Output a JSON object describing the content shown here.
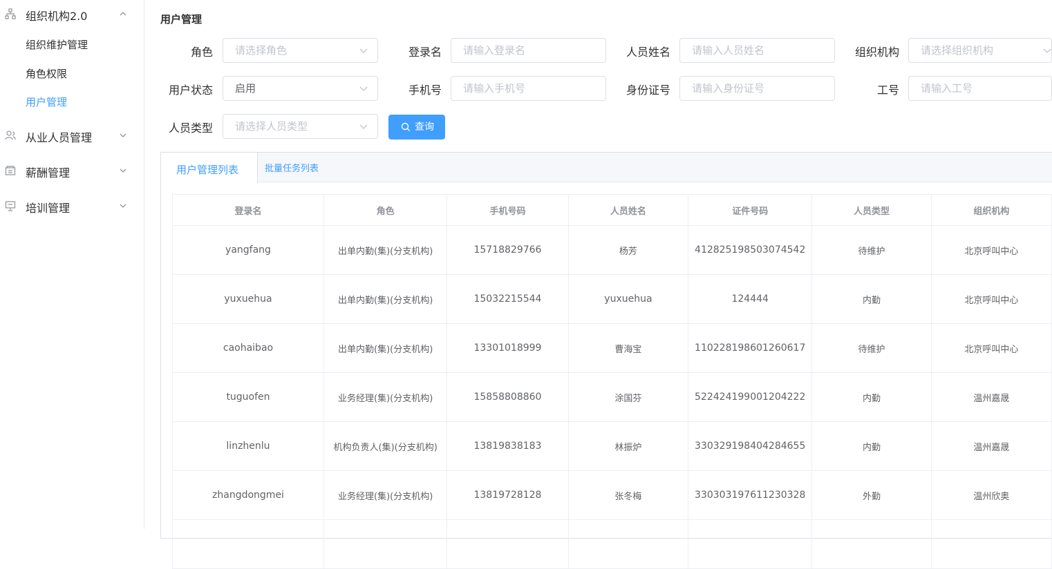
{
  "sidebar": {
    "groups": [
      {
        "label": "组织机构2.0",
        "icon": "org-chart-icon",
        "expanded": true,
        "items": [
          {
            "label": "组织维护管理",
            "active": false
          },
          {
            "label": "角色权限",
            "active": false
          },
          {
            "label": "用户管理",
            "active": true
          }
        ]
      },
      {
        "label": "从业人员管理",
        "icon": "people-icon",
        "expanded": false
      },
      {
        "label": "薪酬管理",
        "icon": "wallet-icon",
        "expanded": false
      },
      {
        "label": "培训管理",
        "icon": "presentation-icon",
        "expanded": false
      }
    ]
  },
  "page": {
    "title": "用户管理"
  },
  "filters": {
    "role": {
      "label": "角色",
      "placeholder": "请选择角色"
    },
    "login": {
      "label": "登录名",
      "placeholder": "请输入登录名"
    },
    "name": {
      "label": "人员姓名",
      "placeholder": "请输入人员姓名"
    },
    "org": {
      "label": "组织机构",
      "placeholder": "请选择组织机构"
    },
    "status": {
      "label": "用户状态",
      "value": "启用"
    },
    "phone": {
      "label": "手机号",
      "placeholder": "请输入手机号"
    },
    "idcard": {
      "label": "身份证号",
      "placeholder": "请输入身份证号"
    },
    "empno": {
      "label": "工号",
      "placeholder": "请输入工号"
    },
    "ptype": {
      "label": "人员类型",
      "placeholder": "请选择人员类型"
    },
    "query_label": "查询"
  },
  "tabs": [
    {
      "label": "用户管理列表",
      "active": true
    },
    {
      "label": "批量任务列表",
      "active": false
    }
  ],
  "table": {
    "columns": [
      "登录名",
      "角色",
      "手机号码",
      "人员姓名",
      "证件号码",
      "人员类型",
      "组织机构"
    ],
    "rows": [
      [
        "yangfang",
        "出单内勤(集)(分支机构)",
        "15718829766",
        "杨芳",
        "412825198503074542",
        "待维护",
        "北京呼叫中心"
      ],
      [
        "yuxuehua",
        "出单内勤(集)(分支机构)",
        "15032215544",
        "yuxuehua",
        "124444",
        "内勤",
        "北京呼叫中心"
      ],
      [
        "caohaibao",
        "出单内勤(集)(分支机构)",
        "13301018999",
        "曹海宝",
        "110228198601260617",
        "待维护",
        "北京呼叫中心"
      ],
      [
        "tuguofen",
        "业务经理(集)(分支机构)",
        "15858808860",
        "涂国芬",
        "522424199001204222",
        "内勤",
        "温州嘉晟"
      ],
      [
        "linzhenlu",
        "机构负责人(集)(分支机构)",
        "13819838183",
        "林振炉",
        "330329198404284655",
        "内勤",
        "温州嘉晟"
      ],
      [
        "zhangdongmei",
        "业务经理(集)(分支机构)",
        "13819728128",
        "张冬梅",
        "330303197611230328",
        "外勤",
        "温州欣奥"
      ],
      [
        "",
        "",
        "",
        "",
        "",
        "",
        ""
      ]
    ]
  },
  "colors": {
    "accent": "#409eff",
    "border": "#dcdfe6",
    "text": "#303133",
    "muted": "#909399"
  }
}
